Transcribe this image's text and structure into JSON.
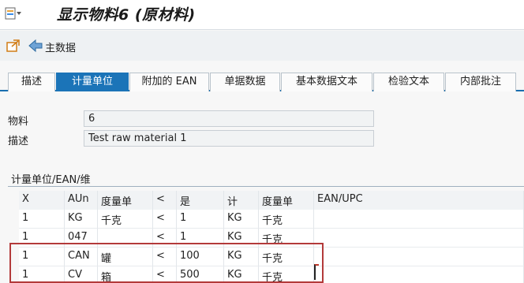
{
  "window": {
    "title": "显示物料6 (原材料)"
  },
  "toolbar": {
    "main_data_label": "主数据"
  },
  "tabs": [
    {
      "label": "描述"
    },
    {
      "label": "计量单位"
    },
    {
      "label": "附加的 EAN"
    },
    {
      "label": "单据数据"
    },
    {
      "label": "基本数据文本"
    },
    {
      "label": "检验文本"
    },
    {
      "label": "内部批注"
    }
  ],
  "form": {
    "material_label": "物料",
    "material_value": "6",
    "description_label": "描述",
    "description_value": "Test raw material 1"
  },
  "section": {
    "title": "计量单位/EAN/维"
  },
  "table": {
    "headers": [
      "X",
      "AUn",
      "度量单",
      "<",
      "是",
      "计",
      "度量单",
      "EAN/UPC"
    ],
    "rows": [
      [
        "1",
        "KG",
        "千克",
        "<",
        "1",
        "KG",
        "千克",
        ""
      ],
      [
        "1",
        "047",
        "",
        "<",
        "1",
        "KG",
        "千克",
        ""
      ],
      [
        "1",
        "CAN",
        "罐",
        "<",
        "100",
        "KG",
        "千克",
        ""
      ],
      [
        "1",
        "CV",
        "箱",
        "<",
        "500",
        "KG",
        "千克",
        ""
      ]
    ]
  },
  "colors": {
    "active_tab": "#1b74b8",
    "highlight_border": "#b33a3a"
  }
}
